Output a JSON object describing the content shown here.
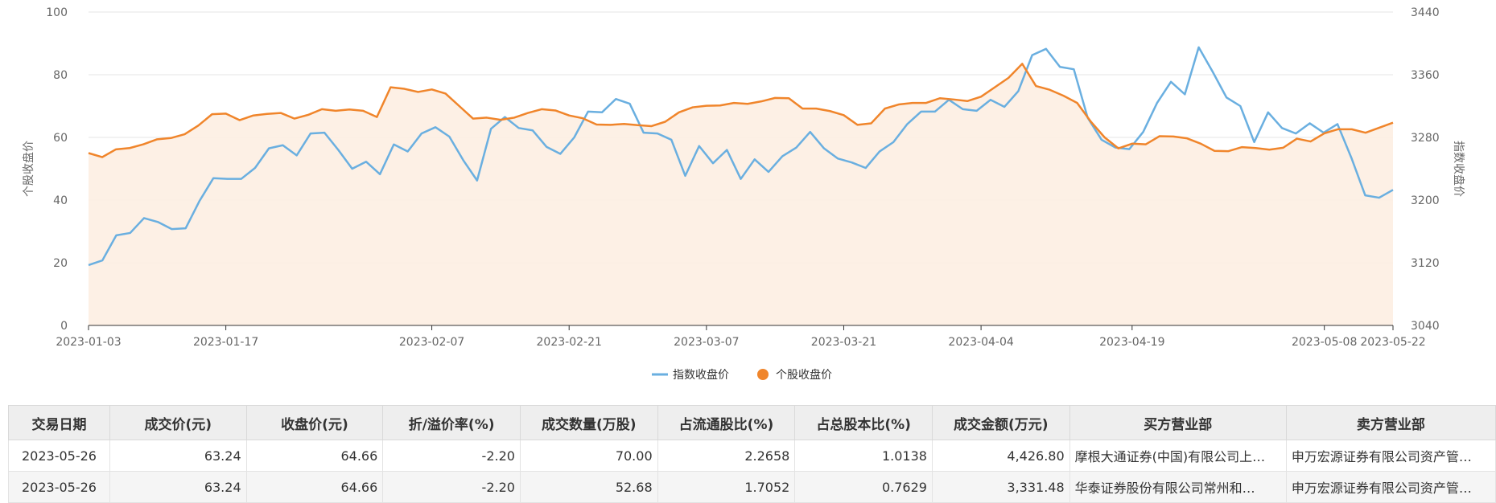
{
  "chart_data": {
    "type": "line",
    "x_ticks": [
      "2023-01-03",
      "2023-01-17",
      "2023-02-07",
      "2023-02-21",
      "2023-03-07",
      "2023-03-21",
      "2023-04-04",
      "2023-04-19",
      "2023-05-08",
      "2023-05-22"
    ],
    "y_left": {
      "label": "个股收盘价",
      "ticks": [
        0,
        20,
        40,
        60,
        80,
        100
      ],
      "range": [
        0,
        100
      ]
    },
    "y_right": {
      "label": "指数收盘价",
      "ticks": [
        3040,
        3120,
        3200,
        3280,
        3360,
        3440
      ],
      "range": [
        3040,
        3440
      ]
    },
    "series": [
      {
        "name": "指数收盘价",
        "axis": "right",
        "color": "#6aafe0",
        "values": [
          3117,
          3123,
          3155,
          3158,
          3177,
          3172,
          3163,
          3164,
          3199,
          3228,
          3227,
          3227,
          3241,
          3266,
          3270,
          3257,
          3285,
          3286,
          3264,
          3240,
          3249,
          3233,
          3271,
          3262,
          3285,
          3293,
          3281,
          3251,
          3225,
          3291,
          3306,
          3292,
          3289,
          3268,
          3259,
          3280,
          3313,
          3312,
          3329,
          3323,
          3286,
          3285,
          3277,
          3231,
          3269,
          3247,
          3264,
          3227,
          3252,
          3236,
          3256,
          3267,
          3287,
          3266,
          3253,
          3248,
          3241,
          3262,
          3274,
          3297,
          3313,
          3313,
          3328,
          3316,
          3314,
          3328,
          3319,
          3339,
          3385,
          3393,
          3370,
          3367,
          3305,
          3277,
          3267,
          3265,
          3287,
          3324,
          3351,
          3335,
          3395,
          3364,
          3331,
          3320,
          3274,
          3312,
          3292,
          3285,
          3298,
          3286,
          3297,
          3254,
          3206,
          3203,
          3213
        ]
      },
      {
        "name": "个股收盘价",
        "axis": "left",
        "color": "#f0852b",
        "values": [
          55.0,
          53.7,
          56.2,
          56.6,
          57.8,
          59.4,
          59.8,
          61.0,
          63.8,
          67.4,
          67.6,
          65.5,
          67.0,
          67.5,
          67.8,
          66.0,
          67.2,
          69.0,
          68.5,
          68.9,
          68.5,
          66.5,
          76.0,
          75.5,
          74.5,
          75.3,
          74.0,
          70.0,
          66.0,
          66.3,
          65.6,
          66.3,
          67.8,
          69.0,
          68.6,
          67.0,
          66.1,
          64.1,
          64.0,
          64.3,
          63.9,
          63.6,
          65.0,
          68.0,
          69.6,
          70.1,
          70.2,
          71.0,
          70.7,
          71.5,
          72.6,
          72.5,
          69.2,
          69.2,
          68.4,
          67.1,
          64.0,
          64.5,
          69.2,
          70.5,
          71.0,
          71.0,
          72.5,
          72.1,
          71.6,
          73.0,
          76.0,
          79.0,
          83.5,
          76.4,
          75.2,
          73.3,
          71.0,
          65.0,
          60.0,
          56.5,
          58.0,
          57.8,
          60.4,
          60.3,
          59.7,
          58.0,
          55.7,
          55.6,
          56.9,
          56.6,
          56.1,
          56.7,
          59.6,
          58.7,
          61.3,
          62.6,
          62.6,
          61.5,
          63.1,
          64.7
        ]
      }
    ],
    "legend": [
      "指数收盘价",
      "个股收盘价"
    ],
    "legend_position": "bottom-center",
    "grid": true
  },
  "table": {
    "headers": [
      "交易日期",
      "成交价(元)",
      "收盘价(元)",
      "折/溢价率(%)",
      "成交数量(万股)",
      "占流通股比(%)",
      "占总股本比(%)",
      "成交金额(万元)",
      "买方营业部",
      "卖方营业部"
    ],
    "rows": [
      [
        "2023-05-26",
        "63.24",
        "64.66",
        "-2.20",
        "70.00",
        "2.2658",
        "1.0138",
        "4,426.80",
        "摩根大通证券(中国)有限公司上…",
        "申万宏源证券有限公司资产管…"
      ],
      [
        "2023-05-26",
        "63.24",
        "64.66",
        "-2.20",
        "52.68",
        "1.7052",
        "0.7629",
        "3,331.48",
        "华泰证券股份有限公司常州和…",
        "申万宏源证券有限公司资产管…"
      ]
    ]
  }
}
